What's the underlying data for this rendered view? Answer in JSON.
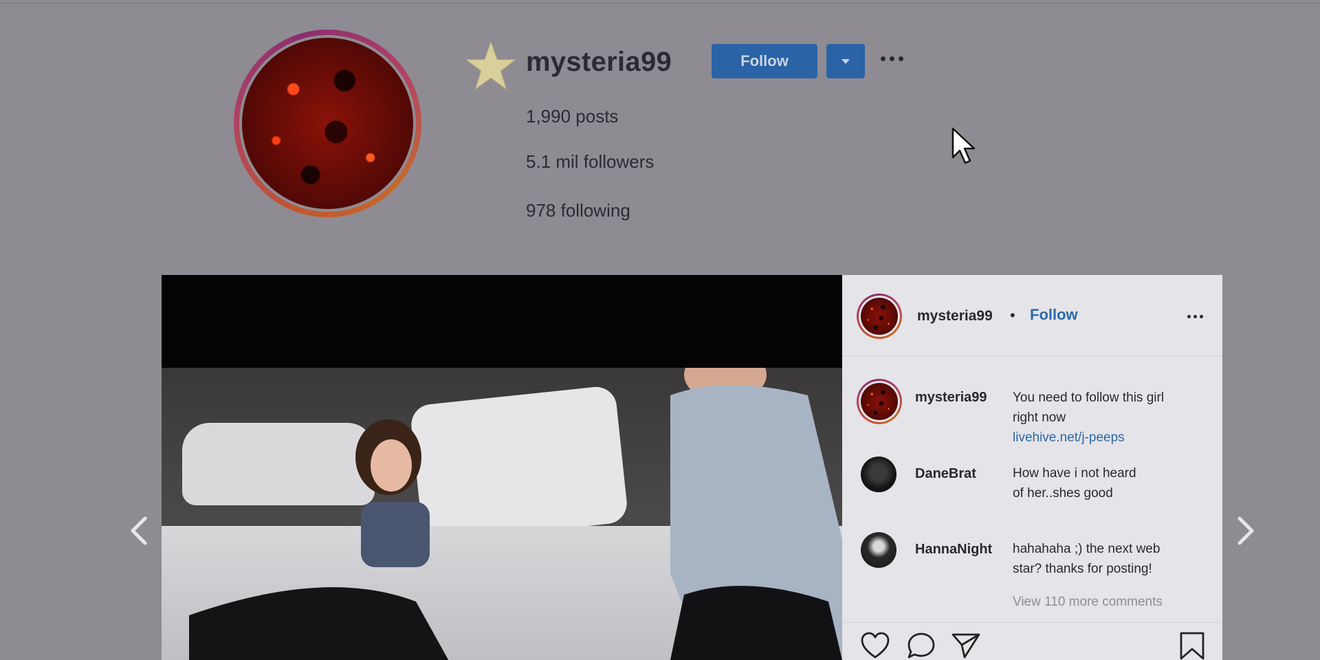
{
  "profile": {
    "username": "mysteria99",
    "follow_label": "Follow",
    "stats": {
      "posts": "1,990 posts",
      "followers": "5.1 mil followers",
      "following": "978 following"
    }
  },
  "post": {
    "header": {
      "username": "mysteria99",
      "separator": "•",
      "follow_label": "Follow"
    },
    "comments": [
      {
        "user": "mysteria99",
        "line1": "You need to follow this girl",
        "line2": "right now",
        "link": "livehive.net/j-peeps"
      },
      {
        "user": "DaneBrat",
        "line1": "How have i not heard",
        "line2": "of her..shes good"
      },
      {
        "user": "HannaNight",
        "line1": "hahahaha ;) the next web",
        "line2": "star? thanks for posting!"
      }
    ],
    "view_more": "View 110 more comments"
  },
  "colors": {
    "accent": "#2a63a6",
    "link": "#2b6aa8",
    "background": "#8f8b92"
  }
}
